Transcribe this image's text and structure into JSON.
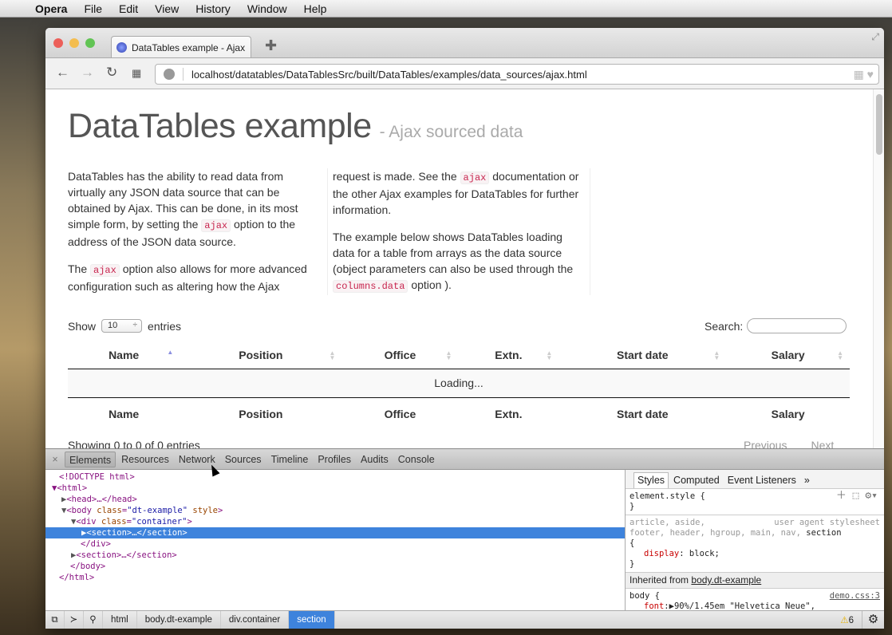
{
  "menubar": {
    "app": "Opera",
    "items": [
      "File",
      "Edit",
      "View",
      "History",
      "Window",
      "Help"
    ]
  },
  "browser": {
    "tab_title": "DataTables example - Ajax",
    "url": "localhost/datatables/DataTablesSrc/built/DataTables/examples/data_sources/ajax.html"
  },
  "page": {
    "title": "DataTables example",
    "subtitle": "- Ajax sourced data",
    "p1": [
      "DataTables has the ability to read data from virtually any JSON data source that can be obtained by Ajax. This can be done, in its most simple form, by setting the ",
      "ajax",
      " option to the address of the JSON data source."
    ],
    "p2": [
      "The ",
      "ajax",
      " option also allows for more advanced configuration such as altering how the Ajax"
    ],
    "p3": [
      "request is made. See the ",
      "ajax",
      " documentation or the other Ajax examples for DataTables for further information."
    ],
    "p4": [
      "The example below shows DataTables loading data for a table from arrays as the data source (object parameters can also be used through the ",
      "columns.data",
      " option )."
    ],
    "length": {
      "show": "Show",
      "value": "10",
      "entries": "entries"
    },
    "search_label": "Search:",
    "columns": [
      "Name",
      "Position",
      "Office",
      "Extn.",
      "Start date",
      "Salary"
    ],
    "loading": "Loading...",
    "info": "Showing 0 to 0 of 0 entries",
    "previous": "Previous",
    "next": "Next"
  },
  "devtools": {
    "tabs": [
      "Elements",
      "Resources",
      "Network",
      "Sources",
      "Timeline",
      "Profiles",
      "Audits",
      "Console"
    ],
    "dom": {
      "doctype": "<!DOCTYPE html>",
      "html": "<html>",
      "head": "<head>…</head>",
      "body_tag": "<body",
      "class_attr": "class",
      "body_class": "\"dt-example\"",
      "style_attr": "style",
      "div_tag": "<div",
      "div_class": "\"container\"",
      "section": "<section>…</section>",
      "div_close": "</div>",
      "body_close": "</body>",
      "html_close": "</html>"
    },
    "style_tabs": [
      "Styles",
      "Computed",
      "Event Listeners",
      "»"
    ],
    "element_style": "element.style {",
    "close_brace": "}",
    "ua_selector1": "article, aside,",
    "ua_source": "user agent stylesheet",
    "ua_selector2": "footer, header, hgroup, main, nav,",
    "ua_selector_match": "section",
    "open_brace": "{",
    "display_prop": "display",
    "display_val": "block;",
    "inherited_label": "Inherited from",
    "inherited_link": "body.dt-example",
    "body_selector": "body {",
    "body_source": "demo.css:3",
    "font_prop": "font",
    "font_val": "90%/1.45em \"Helvetica Neue\",",
    "breadcrumbs": [
      "html",
      "body.dt-example",
      "div.container",
      "section"
    ],
    "warnings": "6"
  }
}
